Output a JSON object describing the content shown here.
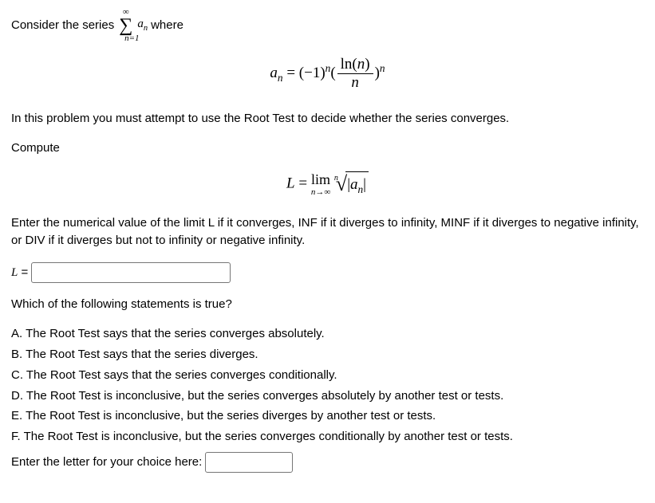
{
  "intro": {
    "prefix": "Consider the series ",
    "sum_top": "∞",
    "sum_bottom": "n=1",
    "term_var": "a",
    "term_sub": "n",
    "suffix": " where"
  },
  "formula1": {
    "lhs_var": "a",
    "lhs_sub": "n",
    "rhs_base": "(−1)",
    "rhs_exp": "n",
    "frac_num_left": "ln(",
    "frac_num_arg": "n",
    "frac_num_right": ")",
    "frac_den": "n",
    "outer_exp": "n"
  },
  "prompt1": "In this problem you must attempt to use the Root Test to decide whether the series converges.",
  "compute_label": "Compute",
  "formula2": {
    "L": "L",
    "eq": " = ",
    "lim": "lim",
    "lim_sub": "n→∞",
    "root_idx": "n",
    "body_left": "|",
    "body_var": "a",
    "body_sub": "n",
    "body_right": "|"
  },
  "instruction": "Enter the numerical value of the limit L if it converges, INF if it diverges to infinity, MINF if it diverges to negative infinity, or DIV if it diverges but not to infinity or negative infinity.",
  "L_label": "L",
  "eq_sign": " = ",
  "question2": "Which of the following statements is true?",
  "options": {
    "A": "A. The Root Test says that the series converges absolutely.",
    "B": "B. The Root Test says that the series diverges.",
    "C": "C. The Root Test says that the series converges conditionally.",
    "D": "D. The Root Test is inconclusive, but the series converges absolutely by another test or tests.",
    "E": "E. The Root Test is inconclusive, but the series diverges by another test or tests.",
    "F": "F. The Root Test is inconclusive, but the series converges conditionally by another test or tests."
  },
  "choice_prompt": "Enter the letter for your choice here: "
}
